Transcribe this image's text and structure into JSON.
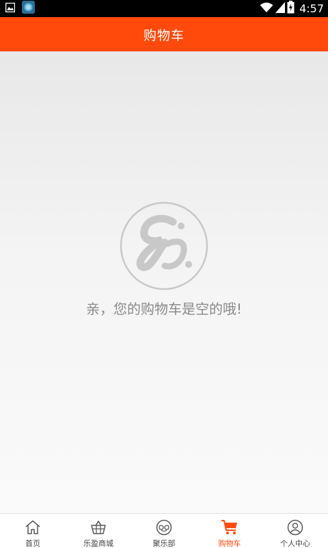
{
  "status_bar": {
    "time": "4:57",
    "icons": [
      "image-notification-icon",
      "app-notification-icon",
      "wifi-icon",
      "signal-icon",
      "battery-icon"
    ]
  },
  "header": {
    "title": "购物车"
  },
  "cart": {
    "empty_message": "亲，您的购物车是空的哦!",
    "empty_icon": "brand-logo-icon"
  },
  "bottom_nav": {
    "items": [
      {
        "label": "首页",
        "icon": "home-icon"
      },
      {
        "label": "乐盈商城",
        "icon": "basket-icon"
      },
      {
        "label": "聚乐部",
        "icon": "club-icon"
      },
      {
        "label": "购物车",
        "icon": "cart-icon",
        "active": true
      },
      {
        "label": "个人中心",
        "icon": "user-icon"
      }
    ]
  },
  "colors": {
    "accent": "#ff4a0c",
    "status_bar": "#000000",
    "empty_text": "#8a8a8a",
    "nav_text": "#444444"
  }
}
